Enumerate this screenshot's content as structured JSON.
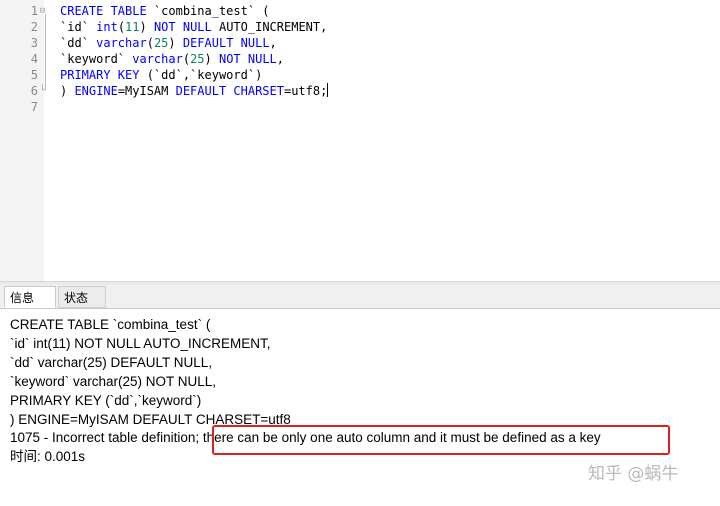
{
  "editor": {
    "line_numbers": [
      "1",
      "2",
      "3",
      "4",
      "5",
      "6",
      "7"
    ],
    "fold_markers": [
      "⊟",
      "└"
    ],
    "lines": [
      [
        {
          "t": "CREATE TABLE ",
          "c": "kw"
        },
        {
          "t": "`combina_test` (",
          "c": "ident"
        }
      ],
      [
        {
          "t": "`id` ",
          "c": "ident"
        },
        {
          "t": "int",
          "c": "kw"
        },
        {
          "t": "(",
          "c": "ident"
        },
        {
          "t": "11",
          "c": "num"
        },
        {
          "t": ") ",
          "c": "ident"
        },
        {
          "t": "NOT NULL ",
          "c": "kw"
        },
        {
          "t": "AUTO_INCREMENT,",
          "c": "ident"
        }
      ],
      [
        {
          "t": "`dd` ",
          "c": "ident"
        },
        {
          "t": "varchar",
          "c": "kw"
        },
        {
          "t": "(",
          "c": "ident"
        },
        {
          "t": "25",
          "c": "num"
        },
        {
          "t": ") ",
          "c": "ident"
        },
        {
          "t": "DEFAULT NULL",
          "c": "kw"
        },
        {
          "t": ",",
          "c": "ident"
        }
      ],
      [
        {
          "t": "`keyword` ",
          "c": "ident"
        },
        {
          "t": "varchar",
          "c": "kw"
        },
        {
          "t": "(",
          "c": "ident"
        },
        {
          "t": "25",
          "c": "num"
        },
        {
          "t": ") ",
          "c": "ident"
        },
        {
          "t": "NOT NULL",
          "c": "kw"
        },
        {
          "t": ",",
          "c": "ident"
        }
      ],
      [
        {
          "t": "PRIMARY KEY ",
          "c": "kw"
        },
        {
          "t": "(`dd`,`keyword`)",
          "c": "ident"
        }
      ],
      [
        {
          "t": ") ",
          "c": "ident"
        },
        {
          "t": "ENGINE",
          "c": "kw"
        },
        {
          "t": "=MyISAM ",
          "c": "ident"
        },
        {
          "t": "DEFAULT CHARSET",
          "c": "kw"
        },
        {
          "t": "=utf8;",
          "c": "ident"
        }
      ],
      []
    ],
    "colors": {
      "keyword": "#0000ff",
      "number": "#098658",
      "identifier": "#000000",
      "gutter_bg": "#f4f4f4"
    }
  },
  "tabs": [
    {
      "label": "信息",
      "active": true
    },
    {
      "label": "状态",
      "active": false
    }
  ],
  "output": {
    "lines": [
      "CREATE TABLE `combina_test` (",
      "`id` int(11) NOT NULL AUTO_INCREMENT,",
      "`dd` varchar(25) DEFAULT NULL,",
      "`keyword` varchar(25) NOT NULL,",
      "PRIMARY KEY (`dd`,`keyword`)",
      ") ENGINE=MyISAM DEFAULT CHARSET=utf8",
      "1075 - Incorrect table definition; there can be only one auto column and it must be defined as a key",
      "时间: 0.001s"
    ],
    "highlight_color": "#e02020"
  },
  "watermark": "知乎 @蜗牛"
}
